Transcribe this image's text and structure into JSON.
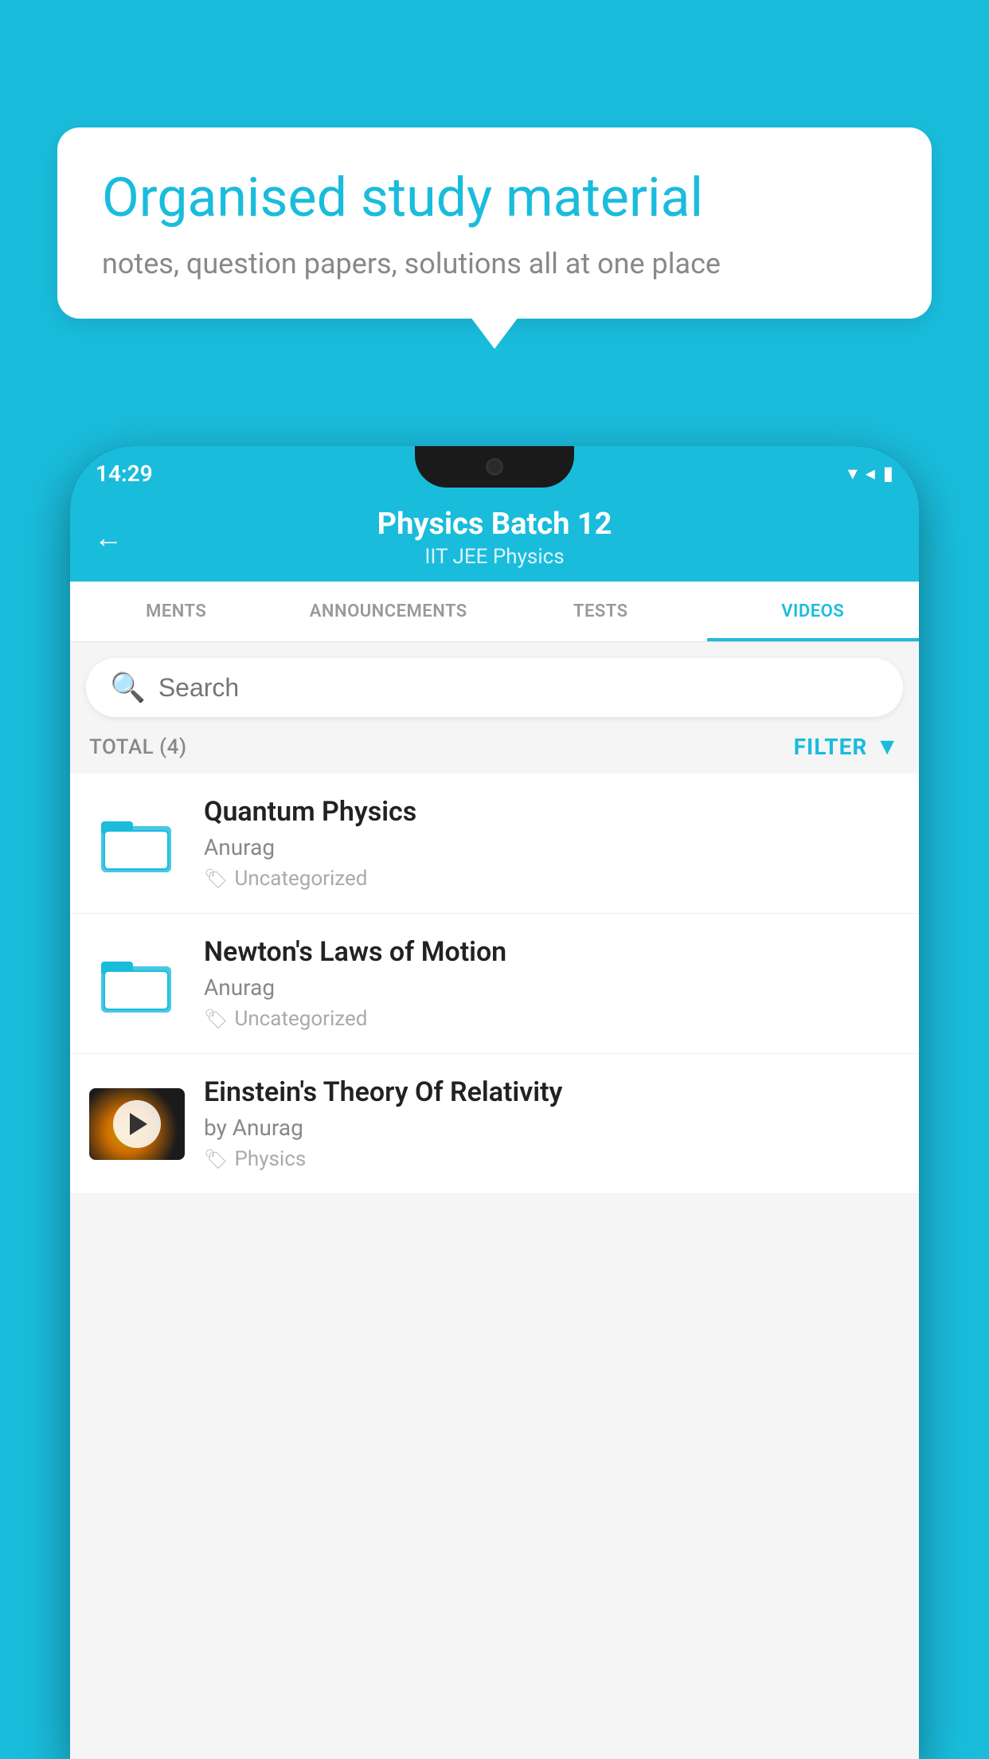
{
  "background_color": "#1ABCDC",
  "speech_bubble": {
    "title": "Organised study material",
    "subtitle": "notes, question papers, solutions all at one place"
  },
  "status_bar": {
    "time": "14:29",
    "icons": [
      "wifi",
      "signal",
      "battery"
    ]
  },
  "header": {
    "back_label": "←",
    "title": "Physics Batch 12",
    "subtitle": "IIT JEE   Physics"
  },
  "tabs": [
    {
      "label": "MENTS",
      "active": false
    },
    {
      "label": "ANNOUNCEMENTS",
      "active": false
    },
    {
      "label": "TESTS",
      "active": false
    },
    {
      "label": "VIDEOS",
      "active": true
    }
  ],
  "search": {
    "placeholder": "Search"
  },
  "filter_row": {
    "total_label": "TOTAL (4)",
    "filter_label": "FILTER"
  },
  "videos": [
    {
      "title": "Quantum Physics",
      "author": "Anurag",
      "tag": "Uncategorized",
      "has_thumbnail": false
    },
    {
      "title": "Newton's Laws of Motion",
      "author": "Anurag",
      "tag": "Uncategorized",
      "has_thumbnail": false
    },
    {
      "title": "Einstein's Theory Of Relativity",
      "author": "by Anurag",
      "tag": "Physics",
      "has_thumbnail": true
    }
  ]
}
